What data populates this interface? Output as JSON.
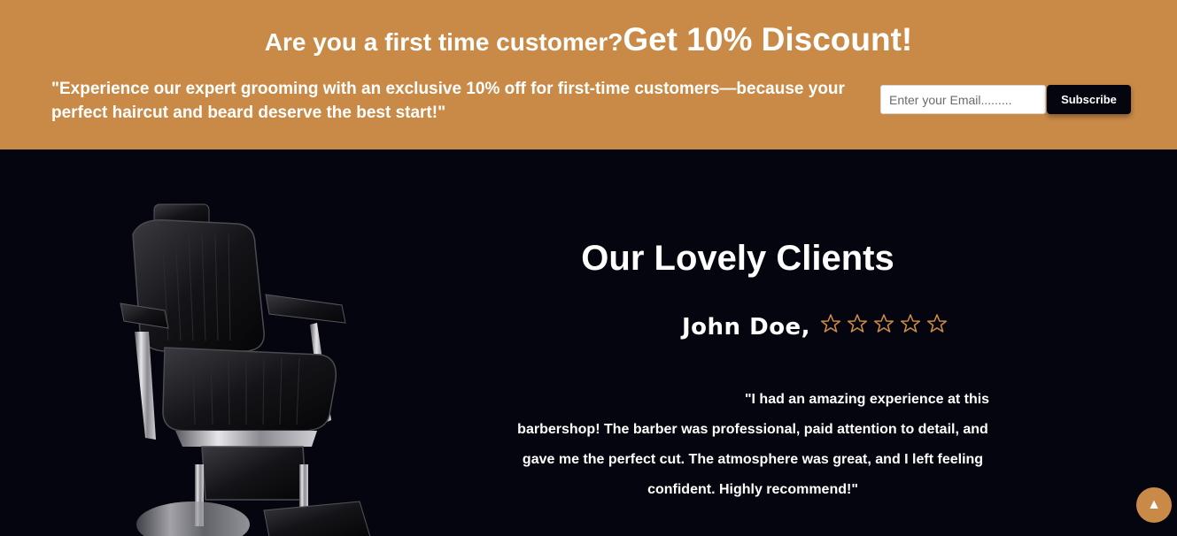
{
  "promo": {
    "question": "Are you a first time customer?",
    "discount": "Get 10% Discount!",
    "text": "\"Experience our expert grooming with an exclusive 10% off for first-time customers—because your perfect haircut and beard deserve the best start!\"",
    "email_placeholder": "Enter your Email.........",
    "subscribe_label": "Subscribe"
  },
  "clients": {
    "title": "Our Lovely Clients",
    "reviewer_name": "John Doe,",
    "rating_stars_filled": 0,
    "rating_stars_total": 5,
    "review": "\"I had an amazing experience at this barbershop! The barber was professional, paid attention to detail, and gave me the perfect cut. The atmosphere was great, and I left feeling confident. Highly recommend!\"",
    "image": "barber-chair"
  },
  "scroll_top": {
    "icon": "arrow-up-icon",
    "glyph": "▲"
  },
  "colors": {
    "accent": "#c98a47",
    "dark_background": "#05050f",
    "text": "#ffffff"
  }
}
